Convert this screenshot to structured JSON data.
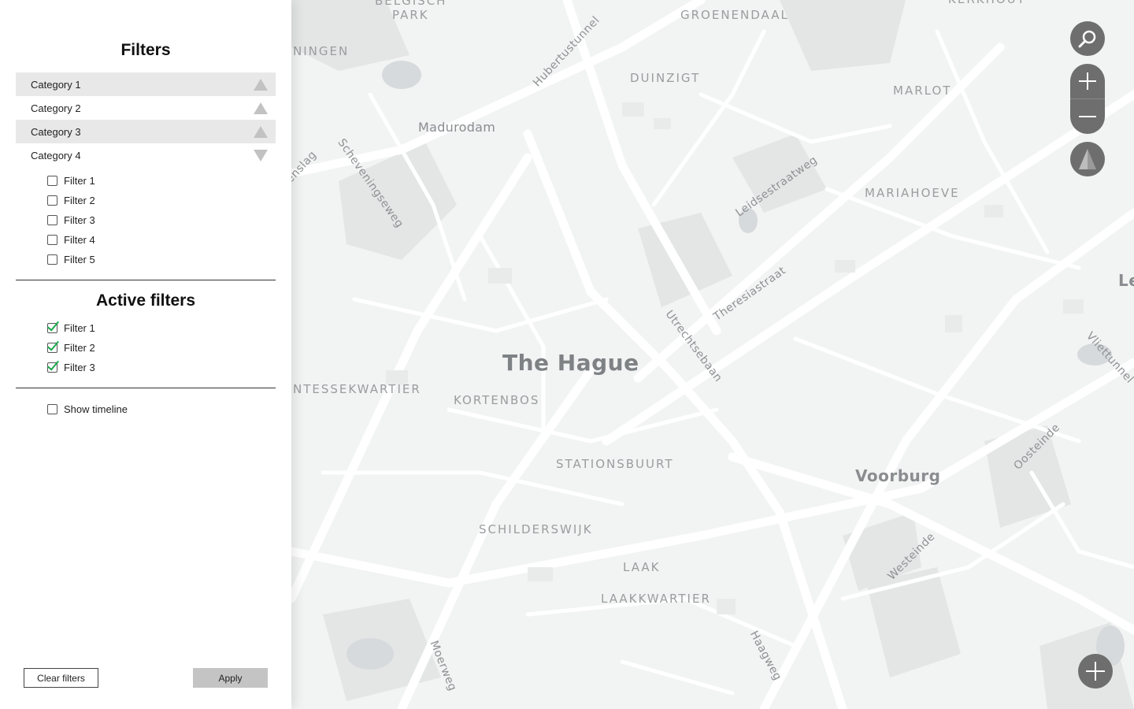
{
  "sidebar": {
    "filters_title": "Filters",
    "categories": [
      {
        "label": "Category 1",
        "expanded": false
      },
      {
        "label": "Category 2",
        "expanded": false
      },
      {
        "label": "Category 3",
        "expanded": false
      },
      {
        "label": "Category 4",
        "expanded": true
      }
    ],
    "category4_filters": [
      "Filter 1",
      "Filter 2",
      "Filter 3",
      "Filter 4",
      "Filter 5"
    ],
    "active_title": "Active filters",
    "active_filters": [
      "Filter 1",
      "Filter 2",
      "Filter 3"
    ],
    "show_timeline_label": "Show timeline",
    "clear_label": "Clear filters",
    "apply_label": "Apply"
  },
  "map": {
    "labels": {
      "belgisch_park": "BELGISCH",
      "park": "PARK",
      "groenendaal": "GROENENDAAL",
      "ningen": "NINGEN",
      "duinzigt": "DUINZIGT",
      "marlot": "MARLOT",
      "madurodam": "Madurodam",
      "hubertustunnel": "Hubertustunnel",
      "enslag": "enslag",
      "scheveningseweg": "Scheveningseweg",
      "leidsestraatweg": "Leidsestraatweg",
      "mariahoeve": "MARIAHOEVE",
      "theresiastraat": "Theresiastraat",
      "utrechtsebaan": "Utrechtsebaan",
      "le": "Le",
      "vliettunnel": "Vliettunnel",
      "the_hague": "The Hague",
      "ntessekwartier": "NTESSEKWARTIER",
      "kortenbos": "KORTENBOS",
      "stationsbuurt": "STATIONSBUURT",
      "voorburg": "Voorburg",
      "oosteinde": "Oosteinde",
      "schilderswijk": "SCHILDERSWIJK",
      "westeinde": "Westeinde",
      "laak": "LAAK",
      "laakkwartier": "LAAKKWARTIER",
      "haagweg": "Haagweg",
      "moerweg": "Moerweg",
      "kerkhout": "KERKHOUT"
    },
    "controls": {
      "search_icon": "search-icon",
      "zoom_in_icon": "plus-icon",
      "zoom_out_icon": "minus-icon",
      "compass_icon": "compass-icon",
      "add_icon": "plus-icon"
    }
  }
}
